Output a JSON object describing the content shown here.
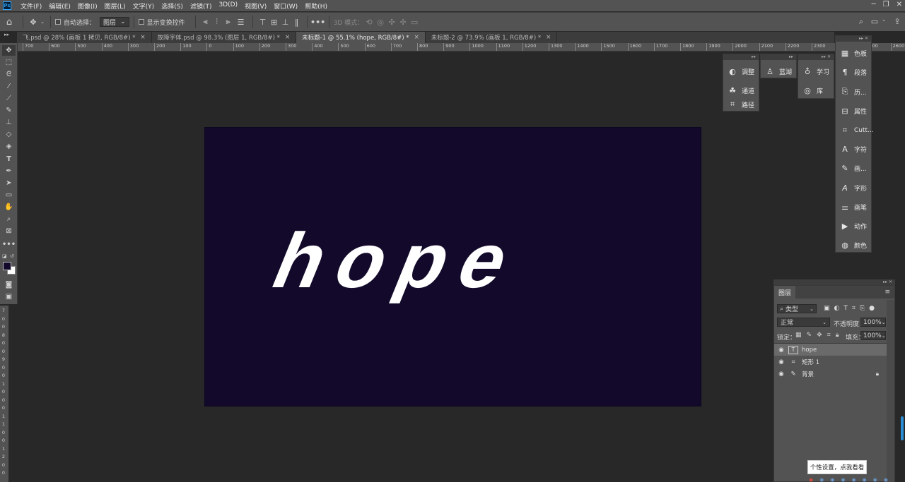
{
  "app": {
    "logo": "Ps"
  },
  "menu": [
    "文件(F)",
    "编辑(E)",
    "图像(I)",
    "图层(L)",
    "文字(Y)",
    "选择(S)",
    "滤镜(T)",
    "3D(D)",
    "视图(V)",
    "窗口(W)",
    "帮助(H)"
  ],
  "options": {
    "auto_select_label": "自动选择：",
    "auto_select_value": "图层",
    "show_transform_label": "显示变换控件",
    "mode_3d_label": "3D 模式："
  },
  "tabs": [
    {
      "label": "飞.psd @ 28% (画板 1 拷贝, RGB/8#) *",
      "close": "×"
    },
    {
      "label": "故障字体.psd @ 98.3% (图层 1, RGB/8#) *",
      "close": "×"
    },
    {
      "label": "未标题-1 @ 55.1% (hope, RGB/8#) *",
      "close": "×"
    },
    {
      "label": "未标题-2 @ 73.9% (画板 1, RGB/8#) *",
      "close": "×"
    }
  ],
  "ruler_h": [
    "700",
    "600",
    "500",
    "400",
    "300",
    "200",
    "100",
    "0",
    "100",
    "200",
    "300",
    "400",
    "500",
    "600",
    "700",
    "800",
    "900",
    "1000",
    "1100",
    "1200",
    "1300",
    "1400",
    "1500",
    "1600",
    "1700",
    "1800",
    "1900",
    "2000",
    "2100",
    "2200",
    "2300",
    "2400",
    "2500",
    "2600"
  ],
  "ruler_v": [
    "7",
    "0",
    "0",
    "8",
    "0",
    "0",
    "9",
    "0",
    "0",
    "1",
    "0",
    "0",
    "0",
    "1",
    "1",
    "0",
    "0",
    "1",
    "2",
    "0",
    "0"
  ],
  "canvas": {
    "text": "hope",
    "bg_color": "#13092a",
    "text_color": "#ffffff"
  },
  "panels_mid": {
    "adjust": "调整",
    "channels": "通道",
    "paths": "路径",
    "blue_lake": "蓝湖",
    "learn": "学习",
    "library": "库"
  },
  "panels_right": [
    "色板",
    "段落",
    "历...",
    "属性",
    "Cutt...",
    "字符",
    "画...",
    "字形",
    "画笔",
    "动作",
    "颜色"
  ],
  "layers": {
    "tab": "图层",
    "filter_label": "类型",
    "blend_mode": "正常",
    "opacity_label": "不透明度：",
    "opacity_value": "100%",
    "lock_label": "锁定：",
    "fill_label": "填充：",
    "fill_value": "100%",
    "items": [
      {
        "name": "hope",
        "type": "text"
      },
      {
        "name": "矩形 1",
        "type": "shape"
      },
      {
        "name": "背景",
        "type": "background"
      }
    ]
  },
  "tooltip": "个性设置，点我看看"
}
